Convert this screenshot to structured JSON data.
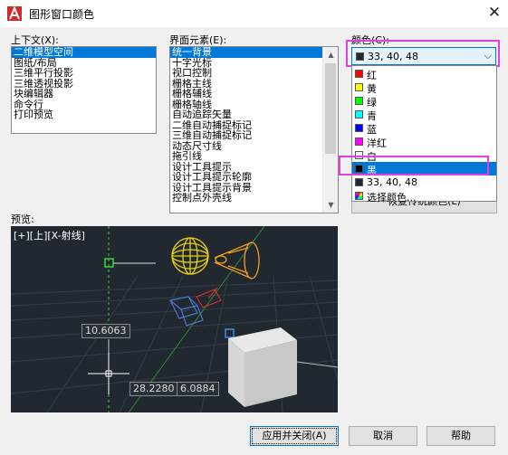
{
  "window": {
    "title": "图形窗口颜色",
    "close_glyph": "✕"
  },
  "context": {
    "label": "上下文(X):",
    "items": [
      "二维模型空间",
      "图纸/布局",
      "三维平行投影",
      "三维透视投影",
      "块编辑器",
      "命令行",
      "打印预览"
    ],
    "selected_index": 0
  },
  "elements": {
    "label": "界面元素(E):",
    "items": [
      "统一背景",
      "十字光标",
      "视口控制",
      "栅格主线",
      "栅格辅线",
      "栅格轴线",
      "自动追踪矢量",
      "二维自动捕捉标记",
      "三维自动捕捉标记",
      "动态尺寸线",
      "拖引线",
      "设计工具提示",
      "设计工具提示轮廓",
      "设计工具提示背景",
      "控制点外壳线"
    ],
    "selected_index": 0
  },
  "color": {
    "label": "颜色(C):",
    "selected_value": "33, 40, 48",
    "selected_swatch": "#212830",
    "options": [
      {
        "label": "红",
        "swatch": "#ff0000"
      },
      {
        "label": "黄",
        "swatch": "#ffff00"
      },
      {
        "label": "绿",
        "swatch": "#00ff00"
      },
      {
        "label": "青",
        "swatch": "#00ffff"
      },
      {
        "label": "蓝",
        "swatch": "#0000ff"
      },
      {
        "label": "洋红",
        "swatch": "#ff00ff"
      },
      {
        "label": "白",
        "swatch": "#ffffff"
      },
      {
        "label": "黑",
        "swatch": "#000000"
      },
      {
        "label": "33, 40, 48",
        "swatch": "#212830"
      },
      {
        "label": "选择颜色...",
        "swatch": "multicolor"
      }
    ],
    "highlighted_index": 7,
    "restore_button_label": "恢复传统颜色(L)"
  },
  "preview": {
    "label": "预览:",
    "viewport_label": "[+][上][X-射线]",
    "dim_values": [
      "10.6063",
      "28.2280",
      "6.0884"
    ]
  },
  "buttons": {
    "apply_close": "应用并关闭(A)",
    "cancel": "取消",
    "help": "帮助"
  },
  "colors": {
    "accent": "#0078d7",
    "highlight_outline": "#e040e0",
    "preview_background": "#212830"
  }
}
